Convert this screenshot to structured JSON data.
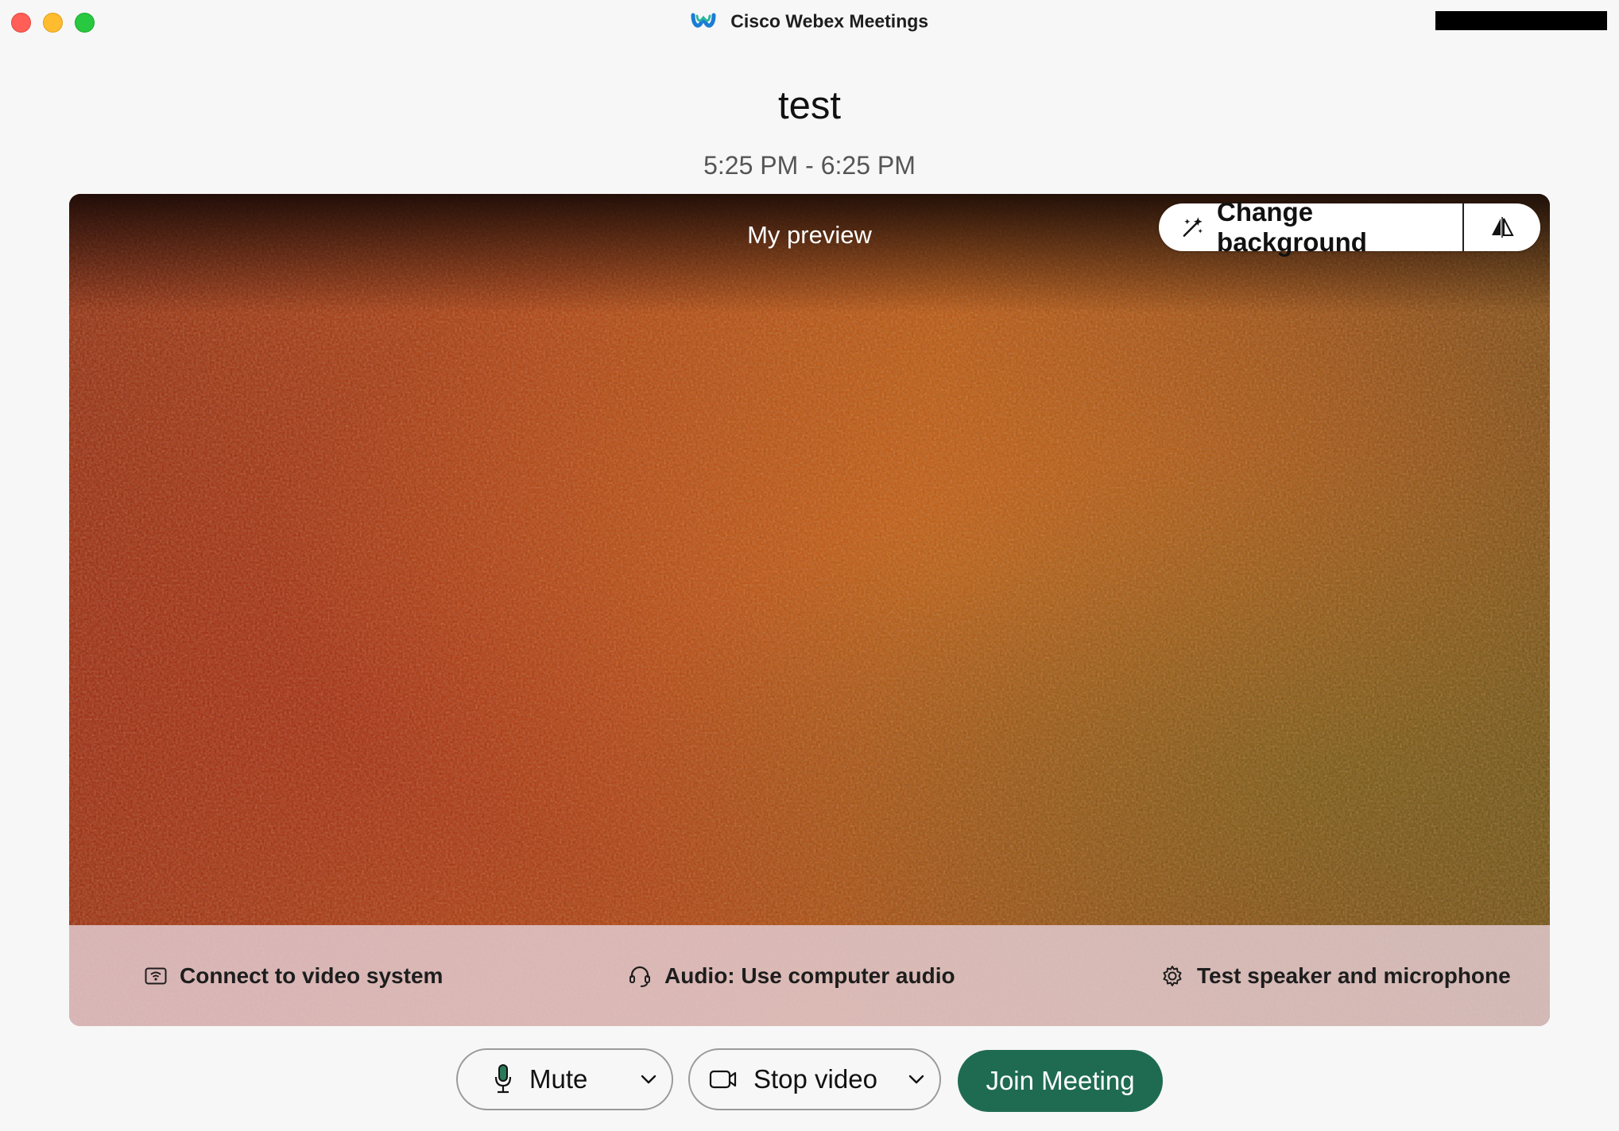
{
  "window": {
    "app_title": "Cisco Webex Meetings",
    "icons": [
      "webex-logo-icon"
    ]
  },
  "meeting": {
    "title": "test",
    "time_range": "5:25 PM - 6:25 PM"
  },
  "preview": {
    "label": "My preview",
    "change_background_label": "Change background",
    "icons": [
      "magic-wand-icon",
      "mirror-icon"
    ]
  },
  "options_bar": {
    "connect_label": "Connect to video system",
    "audio_label": "Audio: Use computer audio",
    "test_label": "Test speaker and microphone",
    "icons": [
      "video-system-icon",
      "headset-icon",
      "gear-icon"
    ]
  },
  "controls": {
    "mute_label": "Mute",
    "stop_video_label": "Stop video",
    "join_label": "Join Meeting",
    "join_color": "#1f6b52",
    "icons": [
      "microphone-icon",
      "camera-icon",
      "chevron-down-icon"
    ]
  }
}
